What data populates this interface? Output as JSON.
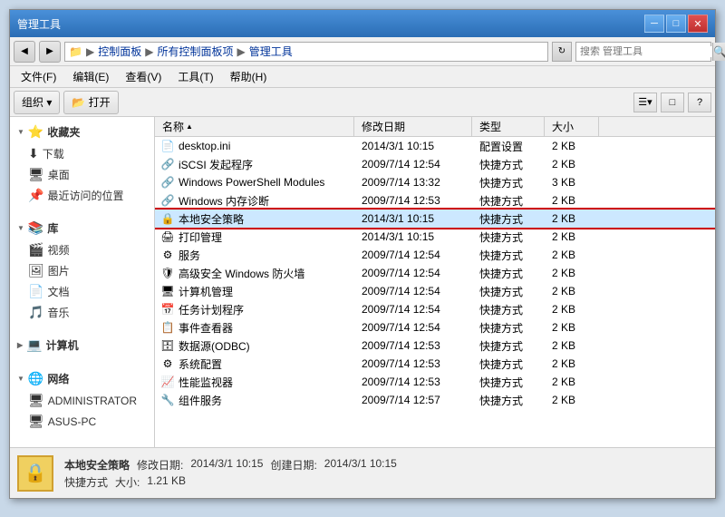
{
  "window": {
    "title": "管理工具",
    "min_label": "─",
    "max_label": "□",
    "close_label": "✕"
  },
  "address": {
    "back_label": "◀",
    "forward_label": "▶",
    "path": [
      {
        "label": "控制面板"
      },
      {
        "label": "所有控制面板项"
      },
      {
        "label": "管理工具"
      }
    ],
    "refresh_label": "↻",
    "search_placeholder": "搜索 管理工具",
    "search_icon": "🔍"
  },
  "menu": {
    "items": [
      {
        "label": "文件(F)"
      },
      {
        "label": "编辑(E)"
      },
      {
        "label": "查看(V)"
      },
      {
        "label": "工具(T)"
      },
      {
        "label": "帮助(H)"
      }
    ]
  },
  "toolbar": {
    "organize_label": "组织 ▾",
    "open_label": "📂 打开",
    "view_icon": "☰",
    "layout_icon": "□",
    "help_icon": "?"
  },
  "sidebar": {
    "sections": [
      {
        "id": "favorites",
        "icon": "⭐",
        "label": "收藏夹",
        "items": [
          {
            "icon": "⬇",
            "label": "下载"
          },
          {
            "icon": "🖥",
            "label": "桌面"
          },
          {
            "icon": "📌",
            "label": "最近访问的位置"
          }
        ]
      },
      {
        "id": "library",
        "icon": "📚",
        "label": "库",
        "items": [
          {
            "icon": "🎬",
            "label": "视频"
          },
          {
            "icon": "🖼",
            "label": "图片"
          },
          {
            "icon": "📄",
            "label": "文档"
          },
          {
            "icon": "🎵",
            "label": "音乐"
          }
        ]
      },
      {
        "id": "computer",
        "icon": "💻",
        "label": "计算机",
        "items": []
      },
      {
        "id": "network",
        "icon": "🌐",
        "label": "网络",
        "items": [
          {
            "icon": "🖥",
            "label": "ADMINISTRATOR"
          },
          {
            "icon": "🖥",
            "label": "ASUS-PC"
          }
        ]
      }
    ]
  },
  "file_list": {
    "headers": [
      {
        "label": "名称",
        "col": "name"
      },
      {
        "label": "修改日期",
        "col": "date"
      },
      {
        "label": "类型",
        "col": "type"
      },
      {
        "label": "大小",
        "col": "size"
      }
    ],
    "files": [
      {
        "name": "desktop.ini",
        "date": "2014/3/1 10:15",
        "type": "配置设置",
        "size": "2 KB",
        "icon": "📄",
        "selected": false,
        "outlined": false
      },
      {
        "name": "iSCSI 发起程序",
        "date": "2009/7/14 12:54",
        "type": "快捷方式",
        "size": "2 KB",
        "icon": "🔗",
        "selected": false,
        "outlined": false
      },
      {
        "name": "Windows PowerShell Modules",
        "date": "2009/7/14 13:32",
        "type": "快捷方式",
        "size": "3 KB",
        "icon": "🔗",
        "selected": false,
        "outlined": false
      },
      {
        "name": "Windows 内存诊断",
        "date": "2009/7/14 12:53",
        "type": "快捷方式",
        "size": "2 KB",
        "icon": "🔗",
        "selected": false,
        "outlined": false
      },
      {
        "name": "本地安全策略",
        "date": "2014/3/1 10:15",
        "type": "快捷方式",
        "size": "2 KB",
        "icon": "🔒",
        "selected": false,
        "outlined": true
      },
      {
        "name": "打印管理",
        "date": "2014/3/1 10:15",
        "type": "快捷方式",
        "size": "2 KB",
        "icon": "🖨",
        "selected": false,
        "outlined": false
      },
      {
        "name": "服务",
        "date": "2009/7/14 12:54",
        "type": "快捷方式",
        "size": "2 KB",
        "icon": "⚙",
        "selected": false,
        "outlined": false
      },
      {
        "name": "高级安全 Windows 防火墙",
        "date": "2009/7/14 12:54",
        "type": "快捷方式",
        "size": "2 KB",
        "icon": "🛡",
        "selected": false,
        "outlined": false
      },
      {
        "name": "计算机管理",
        "date": "2009/7/14 12:54",
        "type": "快捷方式",
        "size": "2 KB",
        "icon": "🖥",
        "selected": false,
        "outlined": false
      },
      {
        "name": "任务计划程序",
        "date": "2009/7/14 12:54",
        "type": "快捷方式",
        "size": "2 KB",
        "icon": "📅",
        "selected": false,
        "outlined": false
      },
      {
        "name": "事件查看器",
        "date": "2009/7/14 12:54",
        "type": "快捷方式",
        "size": "2 KB",
        "icon": "📋",
        "selected": false,
        "outlined": false
      },
      {
        "name": "数据源(ODBC)",
        "date": "2009/7/14 12:53",
        "type": "快捷方式",
        "size": "2 KB",
        "icon": "🗄",
        "selected": false,
        "outlined": false
      },
      {
        "name": "系统配置",
        "date": "2009/7/14 12:53",
        "type": "快捷方式",
        "size": "2 KB",
        "icon": "⚙",
        "selected": false,
        "outlined": false
      },
      {
        "name": "性能监视器",
        "date": "2009/7/14 12:53",
        "type": "快捷方式",
        "size": "2 KB",
        "icon": "📈",
        "selected": false,
        "outlined": false
      },
      {
        "name": "组件服务",
        "date": "2009/7/14 12:57",
        "type": "快捷方式",
        "size": "2 KB",
        "icon": "🔧",
        "selected": false,
        "outlined": false
      }
    ]
  },
  "status_bar": {
    "item_name": "本地安全策略",
    "item_type": "快捷方式",
    "modified_label": "修改日期:",
    "modified_value": "2014/3/1 10:15",
    "created_label": "创建日期:",
    "created_value": "2014/3/1 10:15",
    "size_label": "大小:",
    "size_value": "1.21 KB"
  }
}
